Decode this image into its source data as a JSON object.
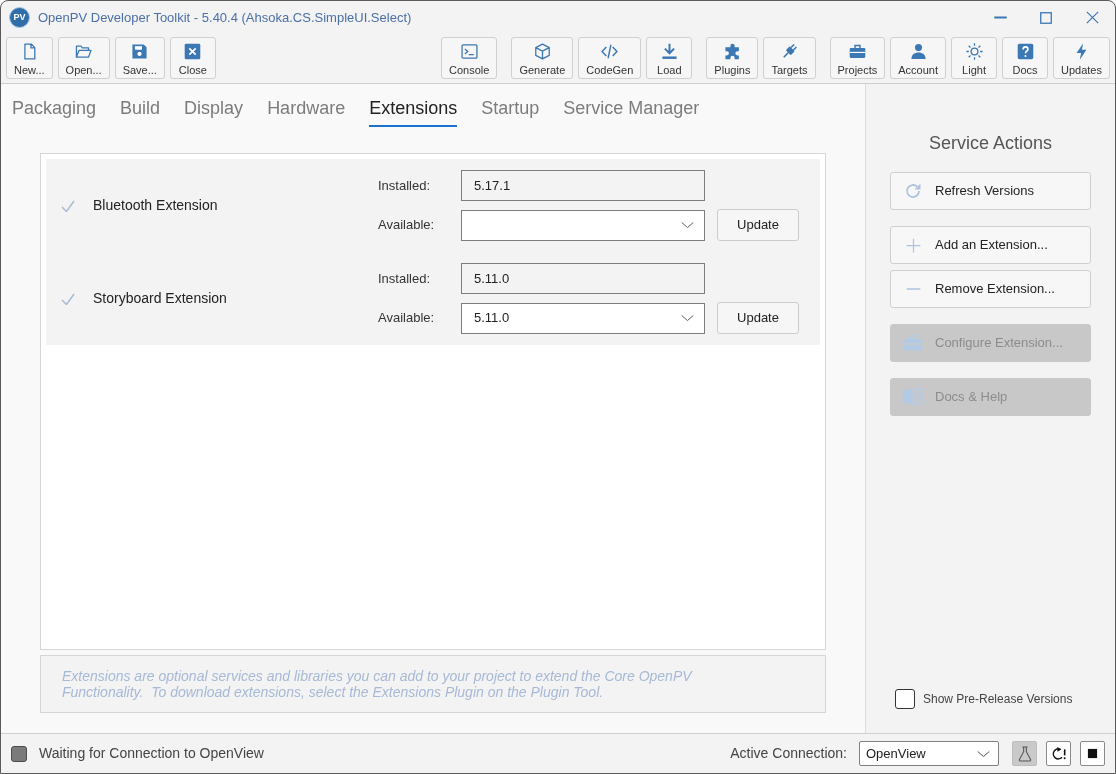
{
  "window": {
    "logo": "PV",
    "title": "OpenPV Developer Toolkit - 5.40.4 (Ahsoka.CS.SimpleUI.Select)"
  },
  "toolbar": {
    "groups": [
      [
        "New...",
        "Open...",
        "Save...",
        "Close"
      ],
      [
        "Console"
      ],
      [
        "Generate",
        "CodeGen",
        "Load"
      ],
      [
        "Plugins",
        "Targets"
      ],
      [
        "Projects",
        "Account",
        "Light",
        "Docs",
        "Updates"
      ]
    ]
  },
  "tabs": [
    {
      "label": "Packaging",
      "selected": false
    },
    {
      "label": "Build",
      "selected": false
    },
    {
      "label": "Display",
      "selected": false
    },
    {
      "label": "Hardware",
      "selected": false
    },
    {
      "label": "Extensions",
      "selected": true
    },
    {
      "label": "Startup",
      "selected": false
    },
    {
      "label": "Service Manager",
      "selected": false
    }
  ],
  "extensions": [
    {
      "name": "Bluetooth Extension",
      "checked": true,
      "installed_label": "Installed:",
      "installed": "5.17.1",
      "available_label": "Available:",
      "button": "Update"
    },
    {
      "name": "Storyboard Extension",
      "checked": true,
      "installed_label": "Installed:",
      "installed": "5.11.0",
      "available_label": "Available:",
      "available": "5.11.0",
      "button": "Update"
    }
  ],
  "info_text": "Extensions are optional services and libraries you can add to your project to extend the Core OpenPV Functionality.  To download extensions, select the Extensions Plugin on the Plugin Tool.",
  "service_actions": {
    "title": "Service Actions",
    "groups": [
      [
        {
          "label": "Refresh Versions",
          "disabled": false
        }
      ],
      [
        {
          "label": "Add an Extension...",
          "disabled": false
        },
        {
          "label": "Remove Extension...",
          "disabled": false
        }
      ],
      [
        {
          "label": "Configure Extension...",
          "disabled": true
        }
      ],
      [
        {
          "label": "Docs & Help",
          "disabled": true
        }
      ]
    ],
    "pre_release": {
      "label": "Show Pre-Release Versions",
      "checked": false
    }
  },
  "status_bar": {
    "message": "Waiting for Connection to OpenView",
    "connection_label": "Active Connection:",
    "connection": "OpenView",
    "buttons": [
      {
        "pressed": true
      },
      {
        "pressed": false
      },
      {
        "pressed": false
      }
    ]
  }
}
